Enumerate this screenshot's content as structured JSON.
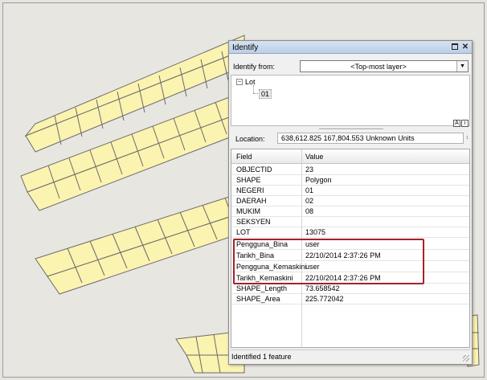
{
  "window": {
    "title": "Identify",
    "identify_from_label": "Identify from:",
    "identify_from_value": "<Top-most layer>"
  },
  "tree": {
    "root_label": "Lot",
    "child_label": "01"
  },
  "location": {
    "label": "Location:",
    "value": "638,612.825  167,804.553 Unknown Units"
  },
  "grid": {
    "headers": {
      "field": "Field",
      "value": "Value"
    },
    "rows": [
      {
        "field": "OBJECTID",
        "value": "23"
      },
      {
        "field": "SHAPE",
        "value": "Polygon"
      },
      {
        "field": "NEGERI",
        "value": "01"
      },
      {
        "field": "DAERAH",
        "value": "02"
      },
      {
        "field": "MUKIM",
        "value": "08"
      },
      {
        "field": "SEKSYEN",
        "value": ""
      },
      {
        "field": "LOT",
        "value": "13075"
      },
      {
        "field": "Pengguna_Bina",
        "value": "user"
      },
      {
        "field": "Tarikh_Bina",
        "value": "22/10/2014 2:37:26 PM"
      },
      {
        "field": "Pengguna_Kemaskini",
        "value": "user"
      },
      {
        "field": "Tarikh_Kemaskini",
        "value": "22/10/2014 2:37:26 PM"
      },
      {
        "field": "SHAPE_Length",
        "value": "73.658542"
      },
      {
        "field": "SHAPE_Area",
        "value": "225.772042"
      }
    ]
  },
  "status": {
    "text": "Identified 1 feature"
  },
  "colors": {
    "parcel_fill": "#fbf3b0",
    "parcel_stroke": "#6a6a6a",
    "map_background": "#e8e6e1",
    "highlight_border": "#a3222c"
  }
}
